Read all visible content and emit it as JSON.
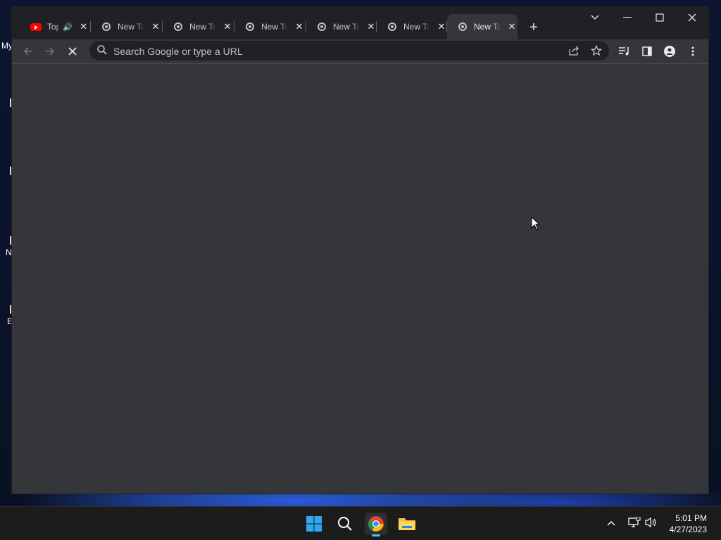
{
  "desktop": {
    "icon_labels": [
      "My",
      "N",
      "E"
    ]
  },
  "browser": {
    "tabs": [
      {
        "title": "Top",
        "favicon": "youtube-icon",
        "audio": true,
        "active": false
      },
      {
        "title": "New Tab",
        "favicon": "chrome-icon",
        "active": false
      },
      {
        "title": "New Tab",
        "favicon": "chrome-icon",
        "active": false
      },
      {
        "title": "New Tab",
        "favicon": "chrome-icon",
        "active": false
      },
      {
        "title": "New Tab",
        "favicon": "chrome-icon",
        "active": false
      },
      {
        "title": "New Tab",
        "favicon": "chrome-icon",
        "active": false
      },
      {
        "title": "New Tab",
        "favicon": "chrome-icon",
        "active": true
      }
    ],
    "omnibox": {
      "placeholder": "Search Google or type a URL",
      "value": ""
    },
    "colors": {
      "frame": "#202124",
      "toolbar": "#35363a",
      "omnibox": "#202124",
      "text": "#e8eaed"
    }
  },
  "taskbar": {
    "apps": [
      "start-icon",
      "search-icon",
      "chrome-icon",
      "file-explorer-icon"
    ],
    "active_app": "chrome-icon",
    "clock": {
      "time": "5:01 PM",
      "date": "4/27/2023"
    }
  }
}
